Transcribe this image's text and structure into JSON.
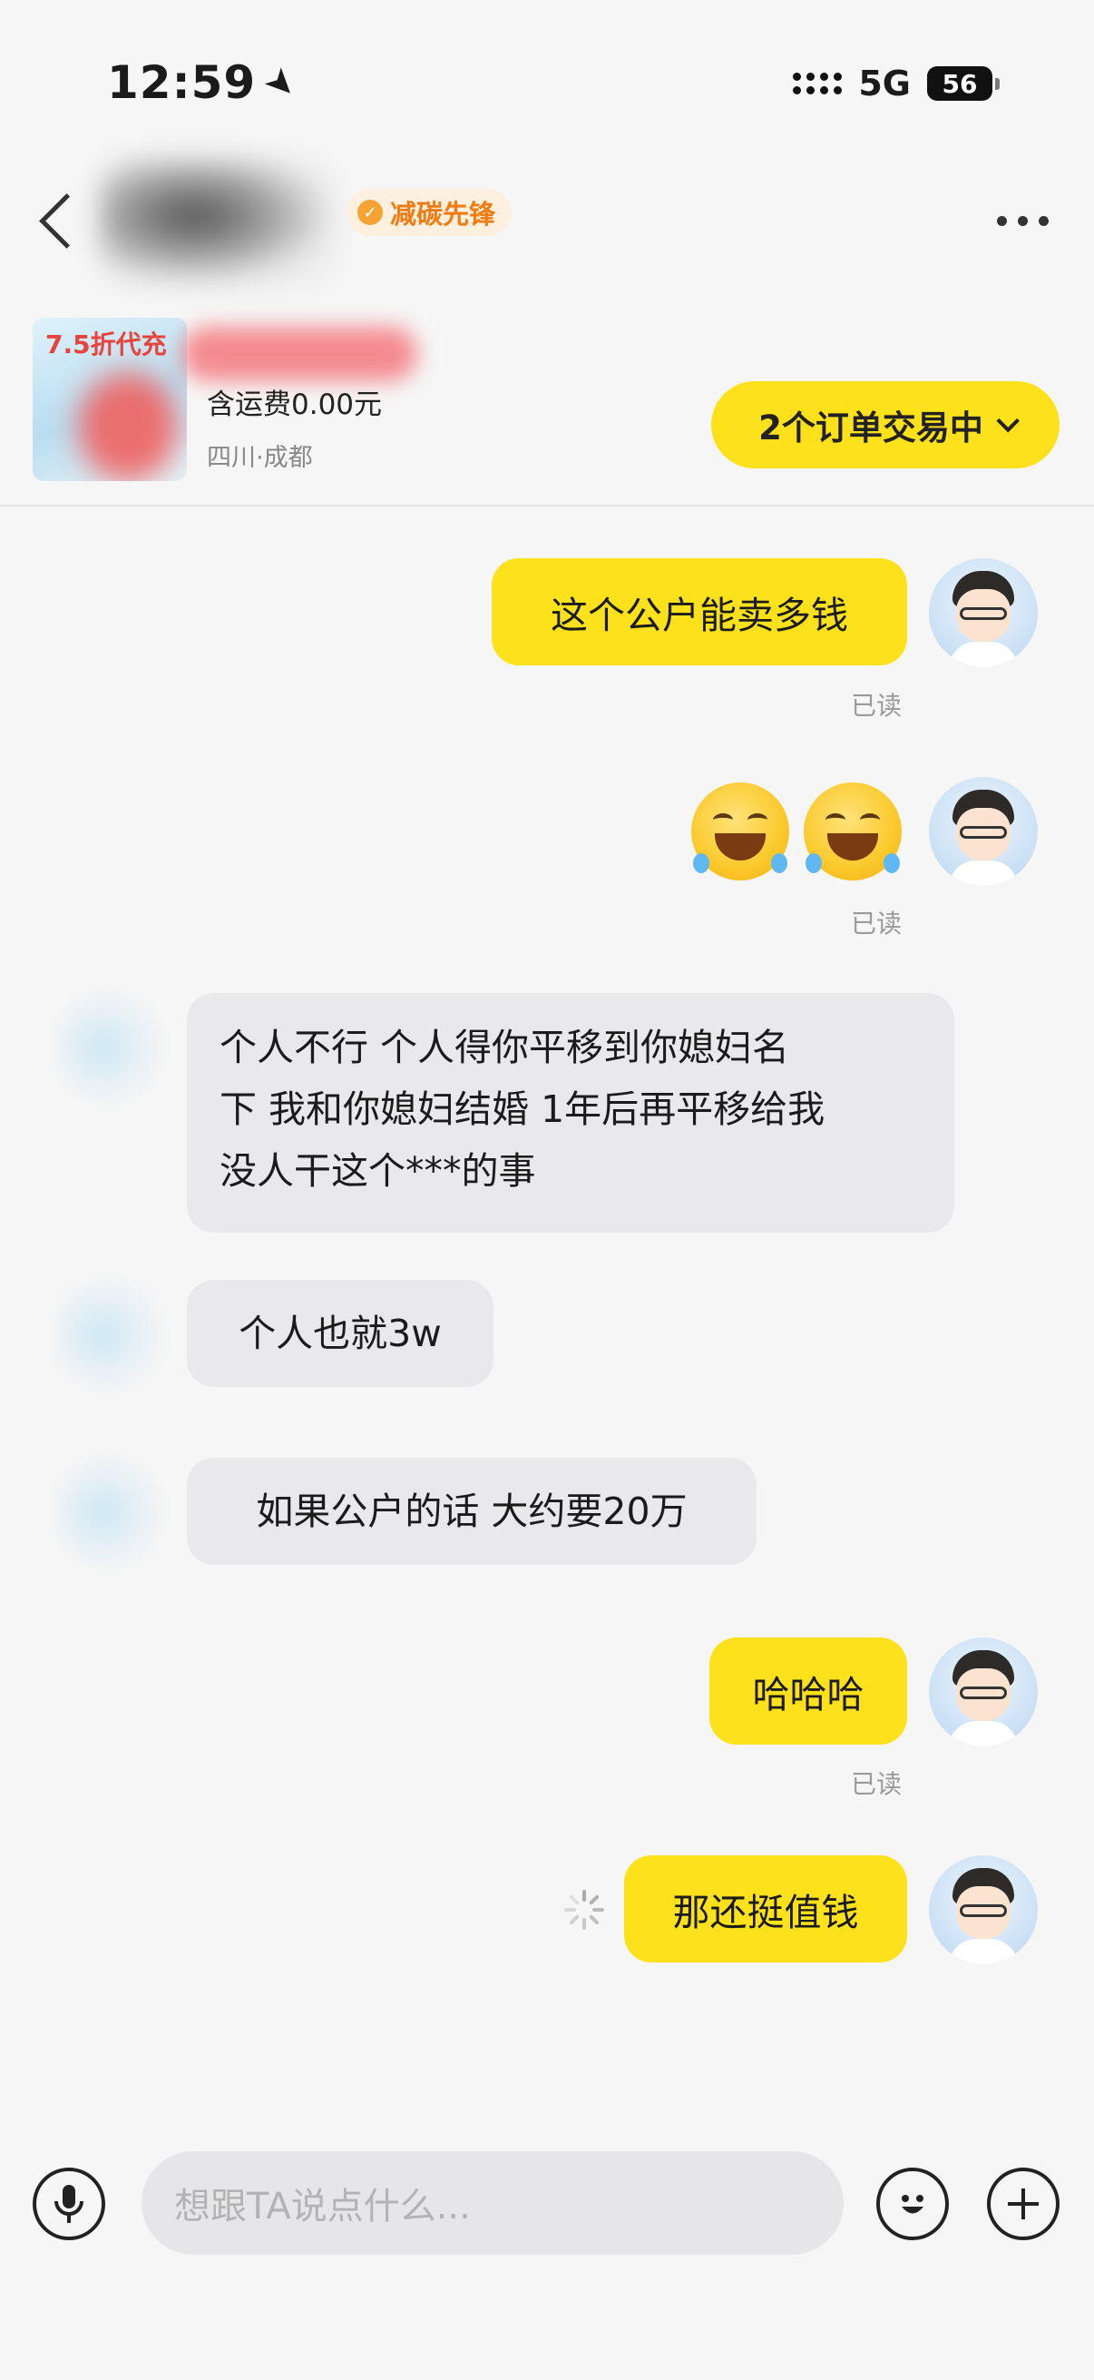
{
  "status_bar": {
    "time": "12:59",
    "network": "5G",
    "battery": "56"
  },
  "header": {
    "badge_label": "减碳先锋"
  },
  "product": {
    "promo_text": "7.5折代充",
    "shipping": "含运费0.00元",
    "location": "四川·成都"
  },
  "orders_button": {
    "label": "2个订单交易中"
  },
  "messages": [
    {
      "sender": "me",
      "text": "这个公户能卖多钱",
      "status": "已读"
    },
    {
      "sender": "me",
      "text": "😂😂",
      "status": "已读"
    },
    {
      "sender": "them",
      "lines": [
        "个人不行 个人得你平移到你媳妇名",
        "下 我和你媳妇结婚 1年后再平移给我",
        "没人干这个***的事"
      ]
    },
    {
      "sender": "them",
      "text": "个人也就3w"
    },
    {
      "sender": "them",
      "text": "如果公户的话 大约要20万"
    },
    {
      "sender": "me",
      "text": "哈哈哈",
      "status": "已读"
    },
    {
      "sender": "me",
      "text": "那还挺值钱",
      "status": "sending"
    }
  ],
  "input": {
    "placeholder": "想跟TA说点什么..."
  },
  "icons": [
    "location-arrow-icon",
    "signal-icon",
    "battery-icon",
    "back-icon",
    "leaf-icon",
    "more-icon",
    "chevron-down-icon",
    "microphone-icon",
    "emoji-icon",
    "plus-icon",
    "sending-spinner-icon"
  ]
}
